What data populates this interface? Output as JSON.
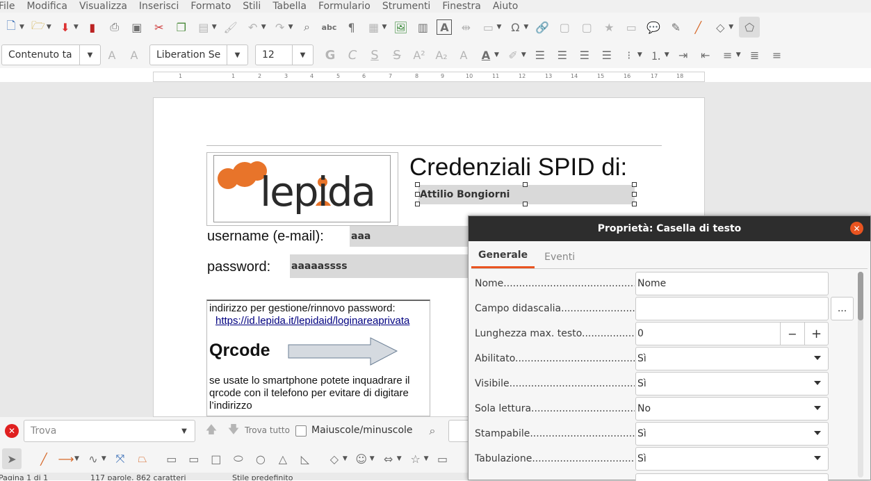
{
  "menu": [
    "File",
    "Modifica",
    "Visualizza",
    "Inserisci",
    "Formato",
    "Stili",
    "Tabella",
    "Formulario",
    "Strumenti",
    "Finestra",
    "Aiuto"
  ],
  "format": {
    "style": "Contenuto ta",
    "font": "Liberation Se",
    "size": "12"
  },
  "format_letters": {
    "bold": "G",
    "italic": "C",
    "underline": "S",
    "strike": "S"
  },
  "ruler": [
    "1",
    "1",
    "2",
    "3",
    "4",
    "5",
    "6",
    "7",
    "8",
    "9",
    "10",
    "11",
    "12",
    "13",
    "14",
    "15",
    "16",
    "17",
    "18"
  ],
  "doc": {
    "title": "Credenziali SPID di:",
    "name_value": "Attilio Bongiorni",
    "username_label": "username (e-mail):",
    "username_value": "aaa",
    "password_label": "password:",
    "password_value": "aaaaassss",
    "logo_text": "lepida",
    "addr_label": "indirizzo per gestione/rinnovo password:",
    "addr_link": "https://id.lepida.it/lepidaid/loginareaprivata",
    "qrcode": "Qrcode",
    "qr_text_1": "se usate lo smartphone potete inquadrare il",
    "qr_text_2": "qrcode con il telefono per evitare di digitare",
    "qr_text_3": "l’indirizzo"
  },
  "dialog": {
    "title": "Proprietà: Casella di testo",
    "tabs": [
      "Generale",
      "Eventi"
    ],
    "rows": [
      {
        "label": "Nome..................................................",
        "value": "Nome"
      },
      {
        "label": "Campo didascalia...........................................",
        "value": ""
      },
      {
        "label": "Lunghezza max. testo..........................................",
        "value": "0"
      },
      {
        "label": "Abilitato..................................................",
        "value": "Sì"
      },
      {
        "label": "Visibile...................................................",
        "value": "Sì"
      },
      {
        "label": "Sola lettura..............................................",
        "value": "No"
      },
      {
        "label": "Stampabile................................................",
        "value": "Sì"
      },
      {
        "label": "Tabulazione..............................................",
        "value": "Sì"
      }
    ],
    "browse": "...",
    "minus": "−",
    "plus": "+"
  },
  "find": {
    "placeholder": "Trova",
    "find_all": "Trova tutto",
    "match_case": "Maiuscole/minuscole"
  },
  "status": {
    "page": "Pagina 1 di 1",
    "words": "117 parole, 862 caratteri",
    "style": "Stile predefinito"
  }
}
